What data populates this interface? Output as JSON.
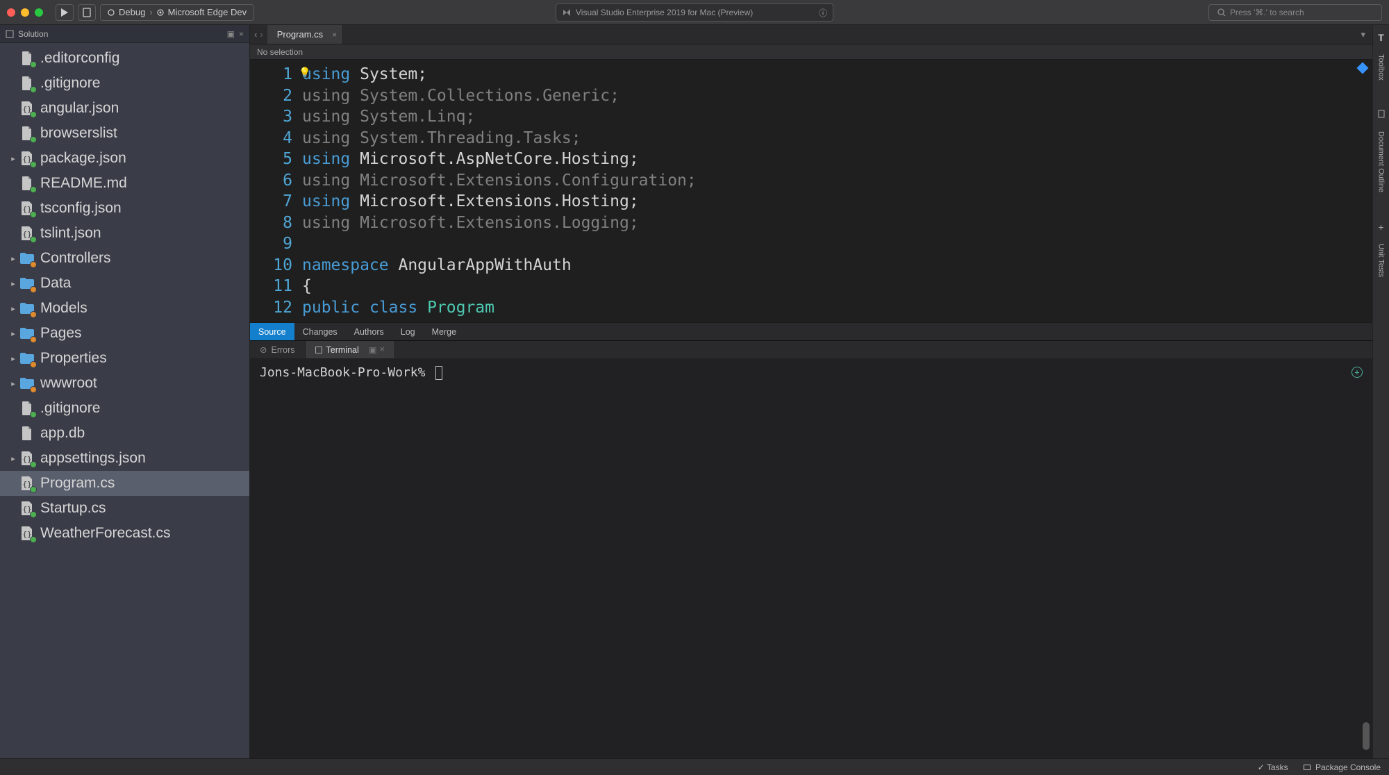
{
  "titlebar": {
    "config_label": "Debug",
    "target_label": "Microsoft Edge Dev",
    "center_title": "Visual Studio Enterprise 2019 for Mac (Preview)",
    "search_placeholder": "Press '⌘.' to search"
  },
  "sidebar": {
    "header": "Solution",
    "items": [
      {
        "label": ".editorconfig",
        "icon": "doc",
        "badge": "add",
        "expand": ""
      },
      {
        "label": ".gitignore",
        "icon": "doc",
        "badge": "add",
        "expand": ""
      },
      {
        "label": "angular.json",
        "icon": "json",
        "badge": "add",
        "expand": ""
      },
      {
        "label": "browserslist",
        "icon": "doc",
        "badge": "add",
        "expand": ""
      },
      {
        "label": "package.json",
        "icon": "json",
        "badge": "add",
        "expand": "▸"
      },
      {
        "label": "README.md",
        "icon": "doc",
        "badge": "add",
        "expand": ""
      },
      {
        "label": "tsconfig.json",
        "icon": "json",
        "badge": "add",
        "expand": ""
      },
      {
        "label": "tslint.json",
        "icon": "json",
        "badge": "add",
        "expand": ""
      },
      {
        "label": "Controllers",
        "icon": "folder",
        "badge": "mod",
        "expand": "▸"
      },
      {
        "label": "Data",
        "icon": "folder",
        "badge": "mod",
        "expand": "▸"
      },
      {
        "label": "Models",
        "icon": "folder",
        "badge": "mod",
        "expand": "▸"
      },
      {
        "label": "Pages",
        "icon": "folder",
        "badge": "mod",
        "expand": "▸"
      },
      {
        "label": "Properties",
        "icon": "folder",
        "badge": "mod",
        "expand": "▸"
      },
      {
        "label": "wwwroot",
        "icon": "folder",
        "badge": "mod",
        "expand": "▸"
      },
      {
        "label": ".gitignore",
        "icon": "doc",
        "badge": "add",
        "expand": ""
      },
      {
        "label": "app.db",
        "icon": "doc",
        "badge": "",
        "expand": ""
      },
      {
        "label": "appsettings.json",
        "icon": "json",
        "badge": "add",
        "expand": "▸"
      },
      {
        "label": "Program.cs",
        "icon": "json",
        "badge": "add",
        "expand": "",
        "selected": true
      },
      {
        "label": "Startup.cs",
        "icon": "json",
        "badge": "add",
        "expand": ""
      },
      {
        "label": "WeatherForecast.cs",
        "icon": "json",
        "badge": "add",
        "expand": ""
      }
    ]
  },
  "editor": {
    "tab_label": "Program.cs",
    "breadcrumb": "No selection",
    "lines": [
      {
        "n": 1,
        "kw": "using",
        "rest": " System;",
        "dim": false,
        "extra_lb": true
      },
      {
        "n": 2,
        "kw": "using",
        "rest": " System.Collections.Generic;",
        "dim": true
      },
      {
        "n": 3,
        "kw": "using",
        "rest": " System.Linq;",
        "dim": true
      },
      {
        "n": 4,
        "kw": "using",
        "rest": " System.Threading.Tasks;",
        "dim": true
      },
      {
        "n": 5,
        "kw": "using",
        "rest": " Microsoft.AspNetCore.Hosting;",
        "dim": false
      },
      {
        "n": 6,
        "kw": "using",
        "rest": " Microsoft.Extensions.Configuration;",
        "dim": true
      },
      {
        "n": 7,
        "kw": "using",
        "rest": " Microsoft.Extensions.Hosting;",
        "dim": false
      },
      {
        "n": 8,
        "kw": "using",
        "rest": " Microsoft.Extensions.Logging;",
        "dim": true
      },
      {
        "n": 9,
        "raw": ""
      },
      {
        "n": 10,
        "ns_kw": "namespace",
        "ns_name": " AngularAppWithAuth"
      },
      {
        "n": 11,
        "raw": "{"
      },
      {
        "n": 12,
        "cls_kw1": "public",
        "cls_kw2": "class",
        "cls_name": "Program",
        "indent": "    "
      }
    ],
    "source_tabs": [
      "Source",
      "Changes",
      "Authors",
      "Log",
      "Merge"
    ]
  },
  "bottom_panel": {
    "tabs": {
      "errors": "Errors",
      "terminal": "Terminal"
    },
    "terminal_prompt": "Jons-MacBook-Pro-Work%"
  },
  "rightstrip": {
    "top": "Toolbox",
    "mid": "Document Outline",
    "bot": "Unit Tests"
  },
  "statusbar": {
    "tasks": "Tasks",
    "package": "Package Console"
  }
}
